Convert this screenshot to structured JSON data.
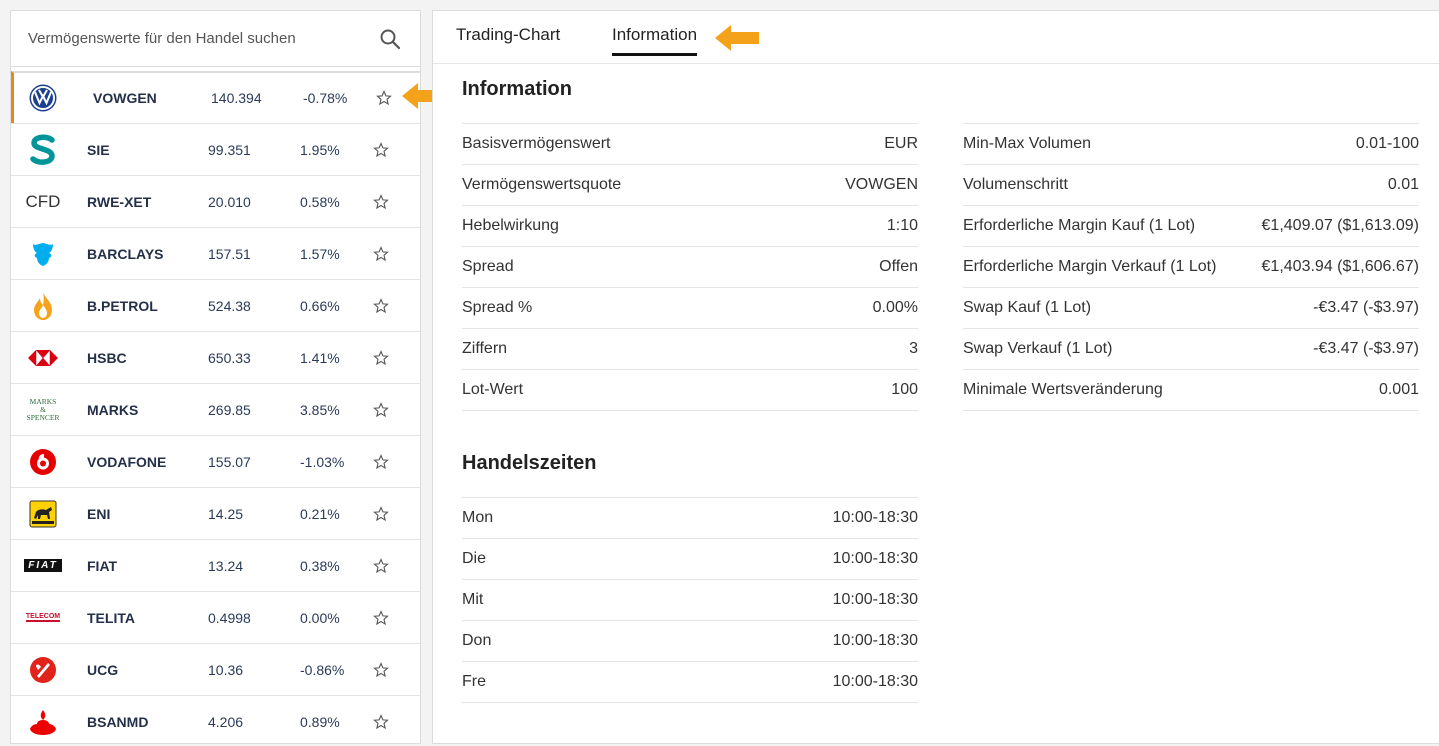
{
  "search": {
    "placeholder": "Vermögenswerte für den Handel suchen"
  },
  "assets": [
    {
      "logo": "vw-logo",
      "symbol": "VOWGEN",
      "price": "140.394",
      "change": "-0.78%"
    },
    {
      "logo": "siemens-logo",
      "symbol": "SIE",
      "price": "99.351",
      "change": "1.95%"
    },
    {
      "logo": "cfd-logo",
      "symbol": "RWE-XET",
      "price": "20.010",
      "change": "0.58%",
      "logo_text": "CFD"
    },
    {
      "logo": "barclays-logo",
      "symbol": "BARCLAYS",
      "price": "157.51",
      "change": "1.57%"
    },
    {
      "logo": "bp-flame-logo",
      "symbol": "B.PETROL",
      "price": "524.38",
      "change": "0.66%"
    },
    {
      "logo": "hsbc-logo",
      "symbol": "HSBC",
      "price": "650.33",
      "change": "1.41%"
    },
    {
      "logo": "marks-spencer-logo",
      "symbol": "MARKS",
      "price": "269.85",
      "change": "3.85%",
      "logo_text": "MARKS & SPENCER"
    },
    {
      "logo": "vodafone-logo",
      "symbol": "VODAFONE",
      "price": "155.07",
      "change": "-1.03%"
    },
    {
      "logo": "eni-logo",
      "symbol": "ENI",
      "price": "14.25",
      "change": "0.21%"
    },
    {
      "logo": "fiat-logo",
      "symbol": "FIAT",
      "price": "13.24",
      "change": "0.38%",
      "logo_text": "FIAT"
    },
    {
      "logo": "telecom-italia-logo",
      "symbol": "TELITA",
      "price": "0.4998",
      "change": "0.00%",
      "logo_text": "TELECOM"
    },
    {
      "logo": "unicredit-logo",
      "symbol": "UCG",
      "price": "10.36",
      "change": "-0.86%"
    },
    {
      "logo": "santander-logo",
      "symbol": "BSANMD",
      "price": "4.206",
      "change": "0.89%"
    }
  ],
  "tabs": [
    {
      "label": "Trading-Chart"
    },
    {
      "label": "Information"
    }
  ],
  "info": {
    "title": "Information",
    "left": [
      {
        "label": "Basisvermögenswert",
        "value": "EUR"
      },
      {
        "label": "Vermögenswertsquote",
        "value": "VOWGEN"
      },
      {
        "label": "Hebelwirkung",
        "value": "1:10"
      },
      {
        "label": "Spread",
        "value": "Offen"
      },
      {
        "label": "Spread %",
        "value": "0.00%"
      },
      {
        "label": "Ziffern",
        "value": "3"
      },
      {
        "label": "Lot-Wert",
        "value": "100"
      }
    ],
    "right": [
      {
        "label": "Min-Max Volumen",
        "value": "0.01-100"
      },
      {
        "label": "Volumenschritt",
        "value": "0.01"
      },
      {
        "label": "Erforderliche Margin Kauf (1 Lot)",
        "value": "€1,409.07 ($1,613.09)"
      },
      {
        "label": "Erforderliche Margin Verkauf (1 Lot)",
        "value": "€1,403.94 ($1,606.67)"
      },
      {
        "label": "Swap Kauf (1 Lot)",
        "value": "-€3.47 (-$3.97)"
      },
      {
        "label": "Swap Verkauf (1 Lot)",
        "value": "-€3.47 (-$3.97)"
      },
      {
        "label": "Minimale Wertsveränderung",
        "value": "0.001"
      }
    ]
  },
  "hours": {
    "title": "Handelszeiten",
    "rows": [
      {
        "day": "Mon",
        "time": "10:00-18:30"
      },
      {
        "day": "Die",
        "time": "10:00-18:30"
      },
      {
        "day": "Mit",
        "time": "10:00-18:30"
      },
      {
        "day": "Don",
        "time": "10:00-18:30"
      },
      {
        "day": "Fre",
        "time": "10:00-18:30"
      }
    ]
  },
  "colors": {
    "accent": "#f5a21b",
    "active_border": "#e58a16"
  }
}
